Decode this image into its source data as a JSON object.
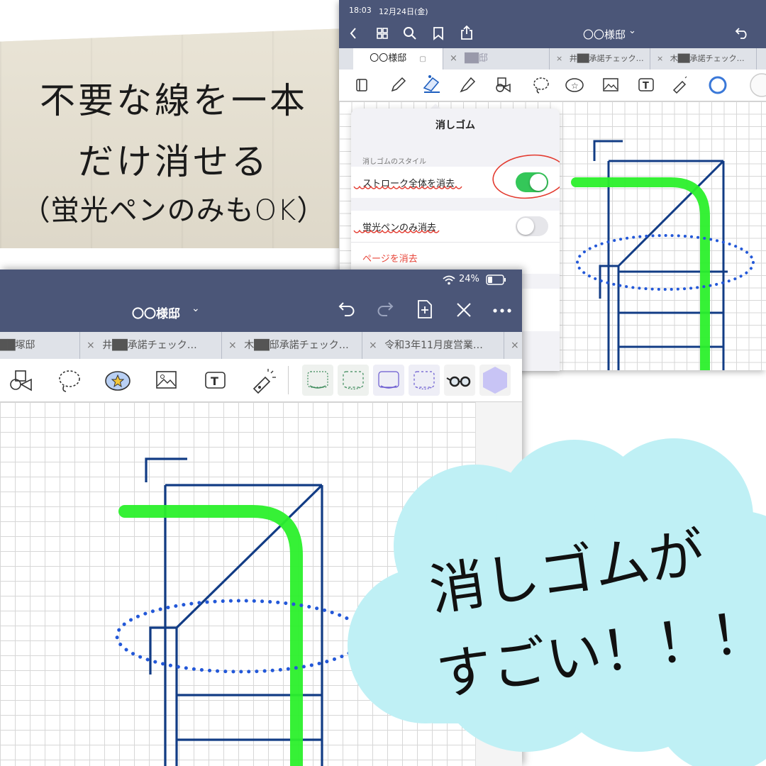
{
  "headline": {
    "line1": "不要な線を一本",
    "line2": "だけ消せる",
    "line3": "（蛍光ペンのみもOK）"
  },
  "cloud_text": {
    "line1": "消しゴムが",
    "line2": "すごい！！！"
  },
  "back_screen": {
    "status_time": "18:03",
    "status_date": "12月24日(金)",
    "title": "〇〇様邸",
    "title_caret": "⌄",
    "tabs": [
      {
        "label": "〇〇様邸",
        "active": true
      },
      {
        "label": "██邸",
        "active": false
      },
      {
        "label": "井██承諾チェック…",
        "active": false
      },
      {
        "label": "木██承諾チェック…",
        "active": false
      }
    ],
    "popover": {
      "title": "消しゴム",
      "section_label": "消しゴムのスタイル",
      "option_stroke": "ストローク全体を消去",
      "option_stroke_on": true,
      "option_highlighter": "蛍光ペンのみ消去",
      "option_highlighter_on": false,
      "clear_page": "ページを消去"
    }
  },
  "front_screen": {
    "battery": "24%",
    "title": "〇〇様邸",
    "title_caret": "⌄",
    "tabs": [
      {
        "label": "██塚邸"
      },
      {
        "label": "井██承諾チェック…"
      },
      {
        "label": "木██邸承諾チェック…"
      },
      {
        "label": "令和3年11月度営業…"
      }
    ]
  },
  "icons": {
    "back": "chevron-left-icon",
    "grid": "grid-icon",
    "search": "search-icon",
    "bookmark": "bookmark-icon",
    "share": "share-icon",
    "undo": "undo-icon",
    "redo": "redo-icon",
    "add_page": "add-page-icon",
    "close_editing": "close-edit-icon",
    "more": "more-icon",
    "wifi": "wifi-icon",
    "battery": "battery-icon"
  },
  "colors": {
    "navbar": "#4b5678",
    "ink_blue": "#123c85",
    "highlighter_green": "#2bf02b",
    "dotted_blue": "#2358d8",
    "cloud": "#bff0f5",
    "toggle_on": "#34c759",
    "danger": "#e8463a",
    "annotation_red": "#e33a2f"
  }
}
